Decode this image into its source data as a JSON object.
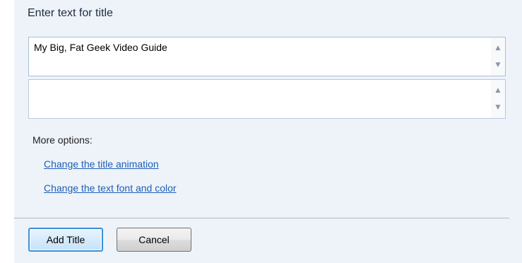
{
  "heading": "Enter text for title",
  "title_lines": [
    {
      "value": "My Big, Fat Geek Video Guide"
    },
    {
      "value": ""
    }
  ],
  "scroll_icons": {
    "up": "scroll-up-arrow-icon",
    "down": "scroll-down-arrow-icon"
  },
  "more_options": {
    "label": "More options:",
    "links": [
      "Change the title animation",
      "Change the text font and color"
    ]
  },
  "buttons": {
    "add_title": "Add Title",
    "cancel": "Cancel"
  },
  "colors": {
    "panel_bg": "#eef3fa",
    "link": "#1e5fb4",
    "primary_border": "#3c8fd6"
  }
}
